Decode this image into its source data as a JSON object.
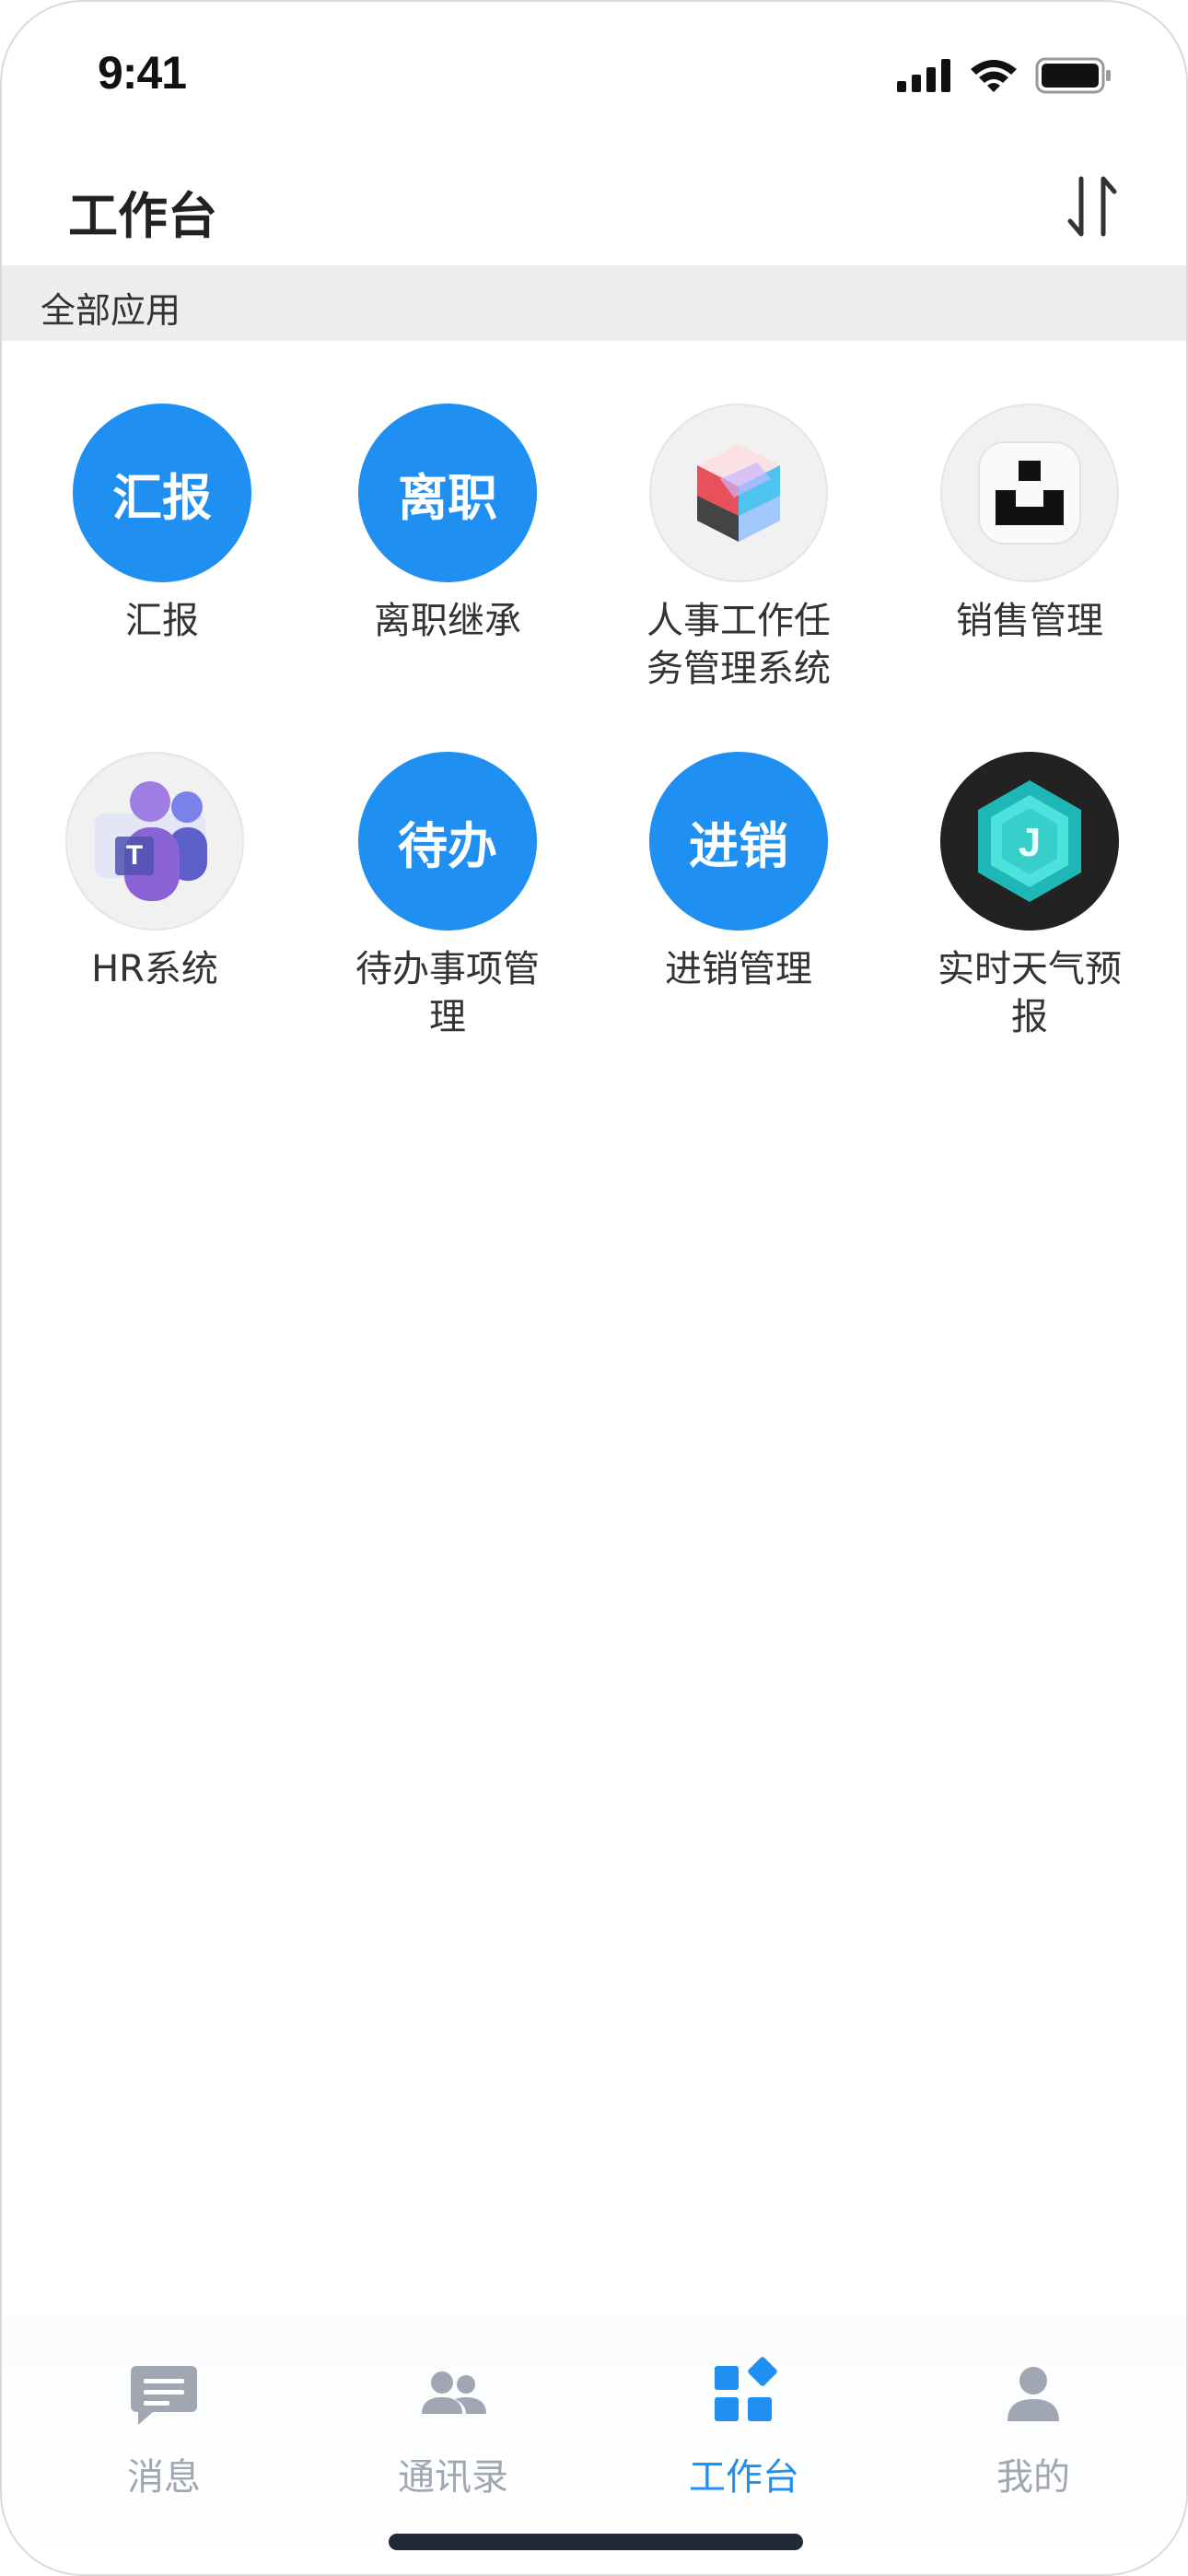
{
  "status_bar": {
    "time": "9:41"
  },
  "header": {
    "title": "工作台"
  },
  "section": {
    "label": "全部应用"
  },
  "apps": [
    {
      "name": "汇报",
      "icon_text": "汇报",
      "icon": "text-badge"
    },
    {
      "name": "离职继承",
      "icon_text": "离职",
      "icon": "text-badge"
    },
    {
      "name": "人事工作任务管理系统",
      "icon": "cube-icon"
    },
    {
      "name": "销售管理",
      "icon": "box-logo-icon"
    },
    {
      "name": "HR系统",
      "icon": "teams-icon"
    },
    {
      "name": "待办事项管理",
      "icon_text": "待办",
      "icon": "text-badge"
    },
    {
      "name": "进销管理",
      "icon_text": "进销",
      "icon": "text-badge"
    },
    {
      "name": "实时天气预报",
      "icon": "hexagon-j-icon"
    }
  ],
  "tabs": [
    {
      "label": "消息",
      "icon": "message-icon",
      "active": false
    },
    {
      "label": "通讯录",
      "icon": "contacts-icon",
      "active": false
    },
    {
      "label": "工作台",
      "icon": "workbench-icon",
      "active": true
    },
    {
      "label": "我的",
      "icon": "profile-icon",
      "active": false
    }
  ],
  "colors": {
    "accent": "#1f8ff2",
    "tab_inactive": "#a0a7b2",
    "section_bg": "#eeeeee"
  }
}
